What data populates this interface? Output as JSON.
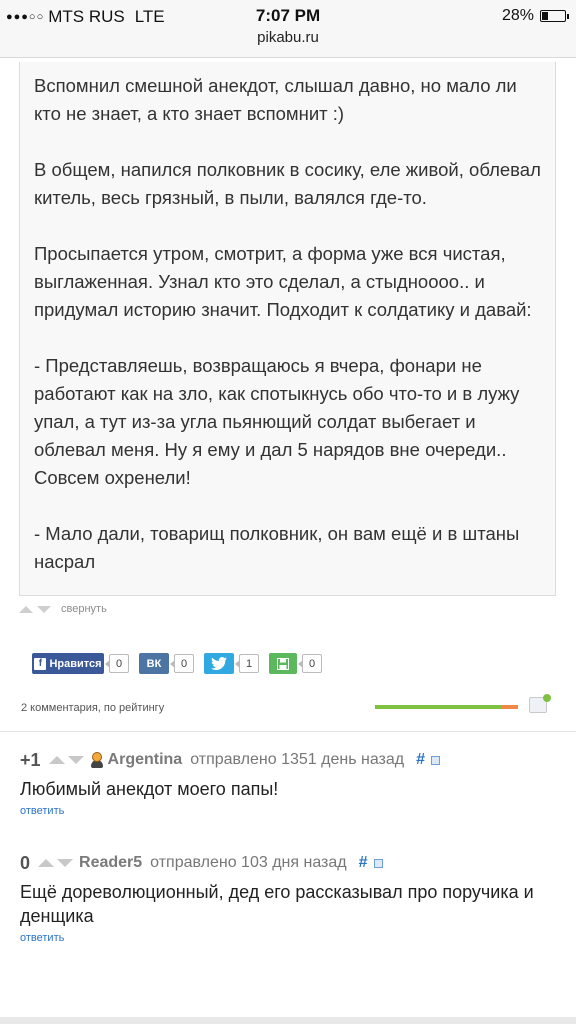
{
  "status_bar": {
    "carrier": "MTS RUS",
    "network": "LTE",
    "time": "7:07 PM",
    "url": "pikabu.ru",
    "battery": "28%",
    "battery_level": 0.28
  },
  "story": {
    "paragraphs": [
      "Вспомнил смешной анекдот, слышал давно, но мало ли кто не знает, а кто знает вспомнит :)",
      "В общем, напился полковник в сосику, еле живой, облевал китель, весь грязный, в пыли, валялся где-то.",
      "Просыпается утром, смотрит, а форма уже вся чистая, выглаженная. Узнал кто это сделал, а стыднoooo.. и придумал историю значит. Подходит к солдатику и давай:",
      "- Представляешь, возвращаюсь я вчера, фонари не работают как на зло, как спотыкнусь обо что-то и в лужу упал, а тут из-за угла пьянющий солдат выбегает и облевал меня. Ну я ему и дал 5 нарядов вне очереди.. Совсем охренели!",
      "- Мало дали, товарищ полковник, он вам ещё и в штаны насрал"
    ],
    "collapse_label": "свернуть"
  },
  "share": {
    "fb_label": "Нравится",
    "fb_count": "0",
    "vk_label": "ВК",
    "vk_count": "0",
    "tw_count": "1",
    "save_count": "0",
    "colors": {
      "fb": "#3b5998",
      "vk": "#4c75a3",
      "tw": "#2fa9e0",
      "save": "#5cb85c"
    }
  },
  "comments_header": {
    "count_label": "2 комментария, по рейтингу",
    "positive_share": 0.89
  },
  "comments": [
    {
      "rating": "+1",
      "author": "Argentina",
      "meta": "отправлено 1351 день назад",
      "hash": "#",
      "text": "Любимый анекдот моего папы!",
      "reply": "ответить"
    },
    {
      "rating": "0",
      "author": "Reader5",
      "meta": "отправлено 103 дня назад",
      "hash": "#",
      "text": "Ещё дореволюционный, дед его рассказывал про поручика и денщика",
      "reply": "ответить"
    }
  ]
}
